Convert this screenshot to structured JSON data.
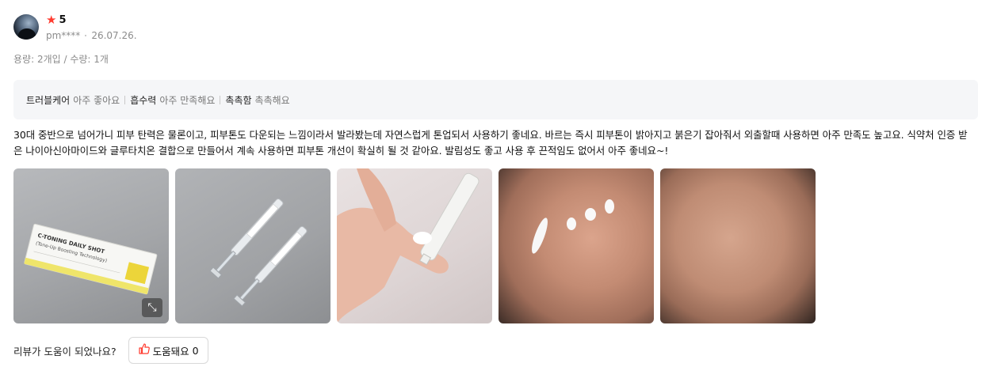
{
  "review": {
    "rating": "5",
    "author": "pm****",
    "date": "26.07.26.",
    "options": "용량: 2개입 / 수량: 1개",
    "evaluations": [
      {
        "key": "트러블케어",
        "value": "아주 좋아요"
      },
      {
        "key": "흡수력",
        "value": "아주 만족해요"
      },
      {
        "key": "촉촉함",
        "value": "촉촉해요"
      }
    ],
    "text": "30대 중반으로 넘어가니 피부 탄력은 물론이고, 피부톤도 다운되는 느낌이라서 발라봤는데 자연스럽게 톤업되서 사용하기 좋네요. 바르는 즉시 피부톤이 밝아지고 붉은기 잡아줘서 외출할때 사용하면 아주 만족도 높고요. 식약처 인증 받은 나이아신아마이드와 글루타치온 결합으로 만들어서 계속 사용하면 피부톤 개선이 확실히 될 것 같아요. 발림성도 좋고 사용 후 끈적임도 없어서 아주 좋네요~!",
    "photo_labels": {
      "box_title": "C-TONING DAILY SHOT",
      "box_sub": "(Tone-Up Boosting Technology)"
    }
  },
  "helpful": {
    "question": "리뷰가 도움이 되었나요?",
    "button_label": "도움돼요",
    "count": "0"
  },
  "colors": {
    "accent": "#ff3b2f",
    "muted_text": "#8c8c8c",
    "eval_bg": "#f5f6f8"
  },
  "icons": {
    "star": "star-icon",
    "expand": "expand-icon",
    "thumb": "thumbs-up-icon"
  }
}
